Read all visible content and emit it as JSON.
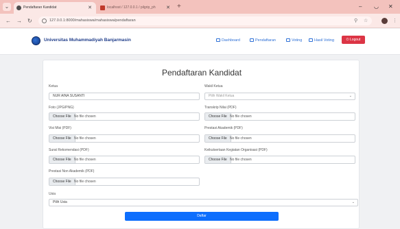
{
  "browser": {
    "tabs": [
      {
        "label": "Pendaftaran Kandidat",
        "active": true
      },
      {
        "label": "localhost / 127.0.0.1 / pilgrip_ph",
        "active": false
      }
    ],
    "new_tab": "+",
    "url": "127.0.0.1:8000/mahasiswa/mahasiswa/pendaftaran",
    "window_controls": {
      "minimize": "–",
      "restore": "◡",
      "close": "✕"
    }
  },
  "navbar": {
    "brand": "Universitas Muhammadiyah Banjarmasin",
    "links": [
      "Dashboard",
      "Pendaftaran",
      "Voting",
      "Hasil Voting"
    ],
    "logout": "Logout",
    "colors": {
      "brand": "#1f3d8a",
      "link": "#2c6fd6",
      "logout": "#dc3545"
    }
  },
  "form": {
    "title": "Pendaftaran Kandidat",
    "ketua_label": "Ketua",
    "ketua_value": "NUR AINA SUSANTI",
    "wakil_label": "Wakil Ketua",
    "wakil_placeholder": "Pilih Wakil Ketua",
    "file_fields": [
      {
        "label": "Foto (JPG/PNG)"
      },
      {
        "label": "Transkrip Nilai (PDF)"
      },
      {
        "label": "Visi Misi (PDF)"
      },
      {
        "label": "Prestasi Akademik (PDF)"
      },
      {
        "label": "Surat Rekomendasi (PDF)"
      },
      {
        "label": "Keikutsertaan Kegiatan Organisasi (PDF)"
      },
      {
        "label": "Prestasi Non Akademik (PDF)"
      }
    ],
    "choose_file": "Choose File",
    "no_file": "No file chosen",
    "usia_label": "Usia",
    "usia_value": "Pilih Usia",
    "submit": "Daftar",
    "colors": {
      "submit": "#0d6efd"
    }
  }
}
